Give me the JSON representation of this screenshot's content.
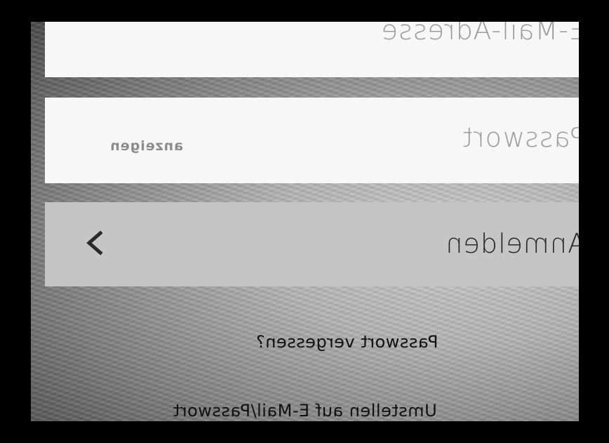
{
  "login": {
    "email_placeholder": "E-Mail-Adresse",
    "password_placeholder": "Passwort",
    "show_password_label": "anzeigen",
    "submit_label": "Anmelden",
    "forgot_password_label": "Passwort vergessen?",
    "switch_method_label": "Umstellen auf E-Mail/Passwort"
  },
  "icons": {
    "submit_chevron": "chevron-right-icon"
  },
  "colors": {
    "field_background": "#f7f7f7",
    "placeholder_text": "#9b9b9b",
    "button_background": "#c5c5c5",
    "button_text": "#2a2a2a",
    "link_text": "#111111",
    "frame": "#000000"
  }
}
